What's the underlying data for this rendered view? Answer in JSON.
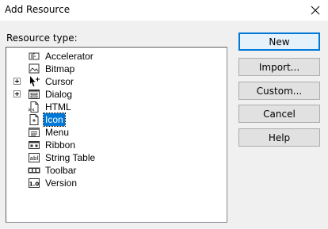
{
  "window": {
    "title": "Add Resource",
    "close_symbol": "✕"
  },
  "resource_type_label": "Resource type:",
  "tree": {
    "items": [
      {
        "label": "Accelerator",
        "icon": "accelerator-icon",
        "expandable": false,
        "selected": false
      },
      {
        "label": "Bitmap",
        "icon": "bitmap-icon",
        "expandable": false,
        "selected": false
      },
      {
        "label": "Cursor",
        "icon": "cursor-icon",
        "expandable": true,
        "selected": false
      },
      {
        "label": "Dialog",
        "icon": "dialog-icon",
        "expandable": true,
        "selected": false
      },
      {
        "label": "HTML",
        "icon": "html-icon",
        "expandable": false,
        "selected": false
      },
      {
        "label": "Icon",
        "icon": "icon-resource-icon",
        "expandable": false,
        "selected": true
      },
      {
        "label": "Menu",
        "icon": "menu-icon",
        "expandable": false,
        "selected": false
      },
      {
        "label": "Ribbon",
        "icon": "ribbon-icon",
        "expandable": false,
        "selected": false
      },
      {
        "label": "String Table",
        "icon": "string-table-icon",
        "expandable": false,
        "selected": false
      },
      {
        "label": "Toolbar",
        "icon": "toolbar-icon",
        "expandable": false,
        "selected": false
      },
      {
        "label": "Version",
        "icon": "version-icon",
        "expandable": false,
        "selected": false
      }
    ]
  },
  "buttons": {
    "new": "New",
    "import": "Import...",
    "custom": "Custom...",
    "cancel": "Cancel",
    "help": "Help"
  },
  "colors": {
    "selection": "#0078d7",
    "default_button_border": "#0078d7"
  }
}
